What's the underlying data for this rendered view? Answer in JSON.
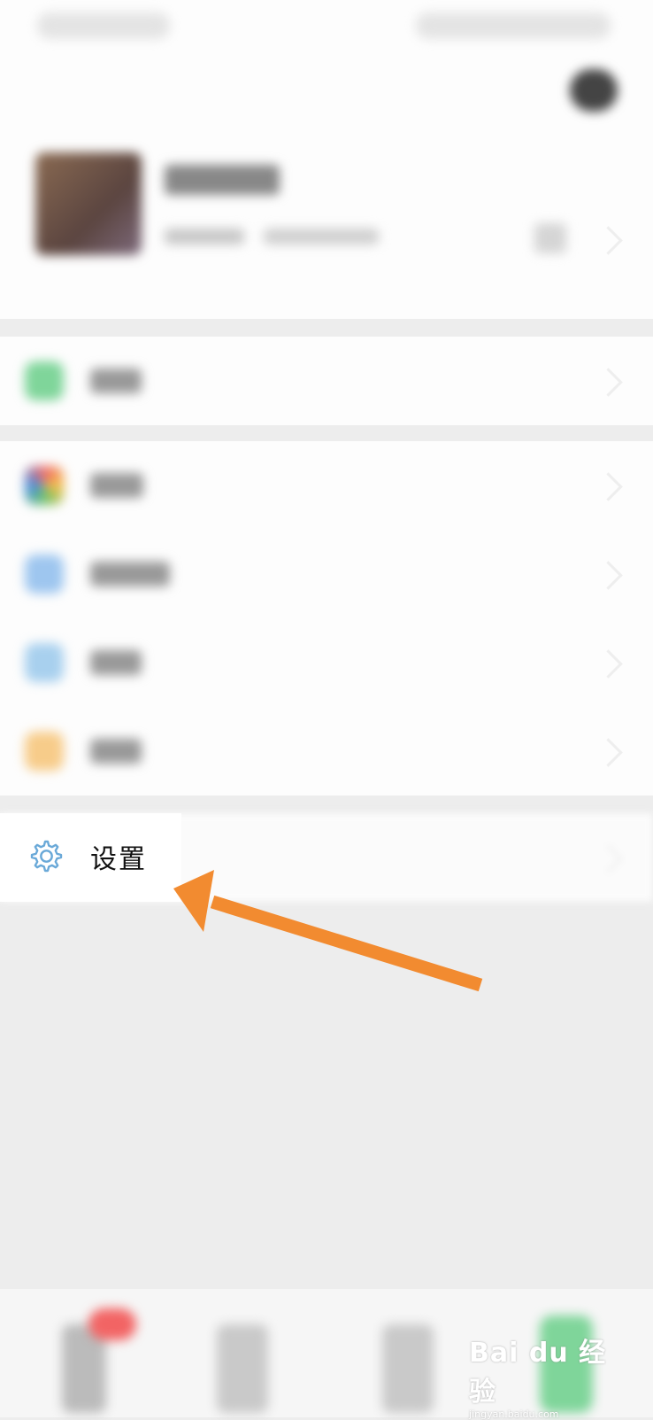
{
  "menu": {
    "settings_label": "设置"
  },
  "watermark": {
    "brand": "Bai du 经验",
    "url": "jingyan.baidu.com"
  },
  "colors": {
    "accent_arrow": "#f28b30",
    "gear_icon": "#6aa9d8",
    "page_bg": "#ededed"
  },
  "icons": {
    "settings": "gear-icon",
    "pointer": "arrow-annotation"
  }
}
